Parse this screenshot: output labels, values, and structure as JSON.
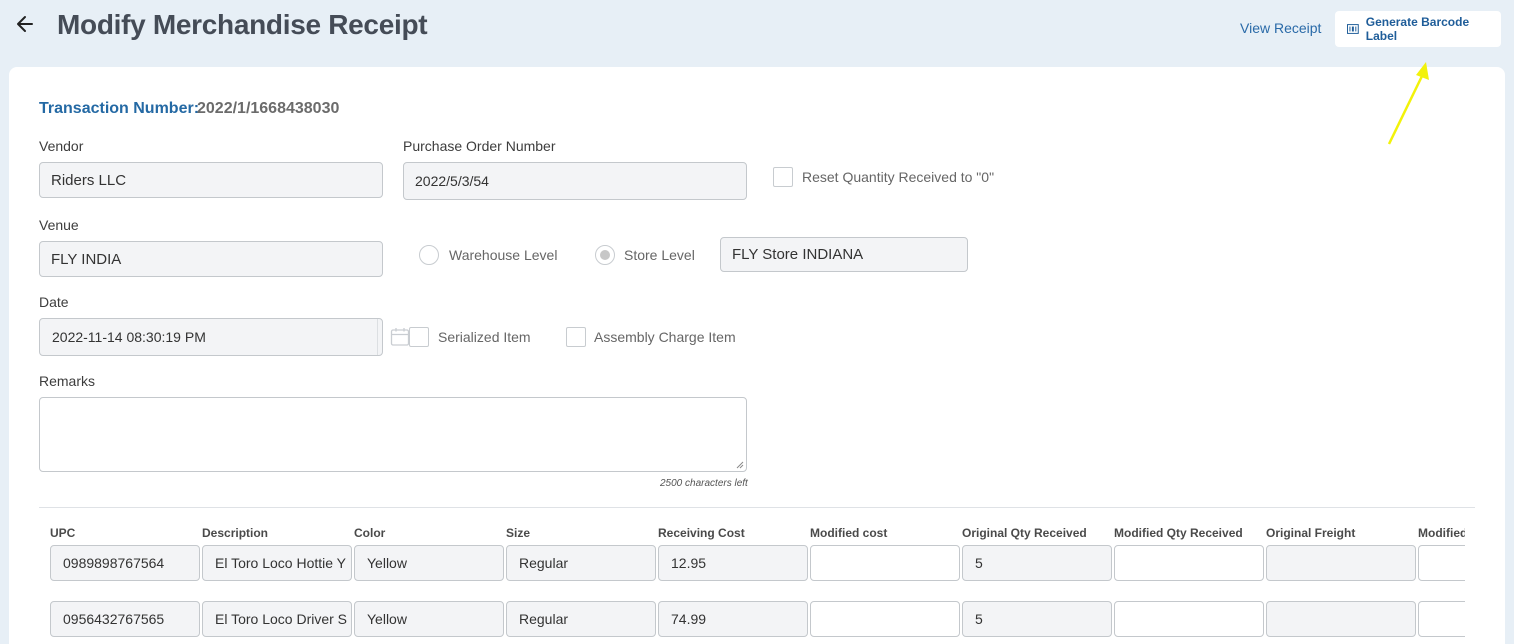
{
  "header": {
    "title": "Modify Merchandise Receipt",
    "view_receipt": "View Receipt",
    "generate_barcode": "Generate Barcode Label"
  },
  "form": {
    "transaction_label": "Transaction Number:",
    "transaction_value": "2022/1/1668438030",
    "vendor_label": "Vendor",
    "vendor_value": "Riders LLC",
    "po_label": "Purchase Order Number",
    "po_value": "2022/5/3/54",
    "reset_qty_label": "Reset Quantity Received to \"0\"",
    "venue_label": "Venue",
    "venue_value": "FLY INDIA",
    "warehouse_label": "Warehouse Level",
    "store_label": "Store Level",
    "store_value": "FLY Store INDIANA",
    "date_label": "Date",
    "date_value": "2022-11-14 08:30:19 PM",
    "serialized_label": "Serialized Item",
    "assembly_label": "Assembly Charge Item",
    "remarks_label": "Remarks",
    "chars_left": "2500 characters left"
  },
  "table": {
    "headers": [
      "UPC",
      "Description",
      "Color",
      "Size",
      "Receiving Cost",
      "Modified cost",
      "Original Qty Received",
      "Modified Qty Received",
      "Original Freight",
      "Modified"
    ],
    "rows": [
      [
        "0989898767564",
        "El Toro Loco Hottie Y",
        "Yellow",
        "Regular",
        "12.95",
        "",
        "5",
        "",
        "",
        ""
      ],
      [
        "0956432767565",
        "El Toro Loco Driver S",
        "Yellow",
        "Regular",
        "74.99",
        "",
        "5",
        "",
        "",
        ""
      ]
    ]
  },
  "colors": {
    "accent": "#2469a4",
    "background": "#e7eff6",
    "annotation_arrow": "#f2f20a"
  },
  "icons": [
    "back-arrow-icon",
    "barcode-icon",
    "calendar-icon",
    "resize-grip-icon"
  ]
}
